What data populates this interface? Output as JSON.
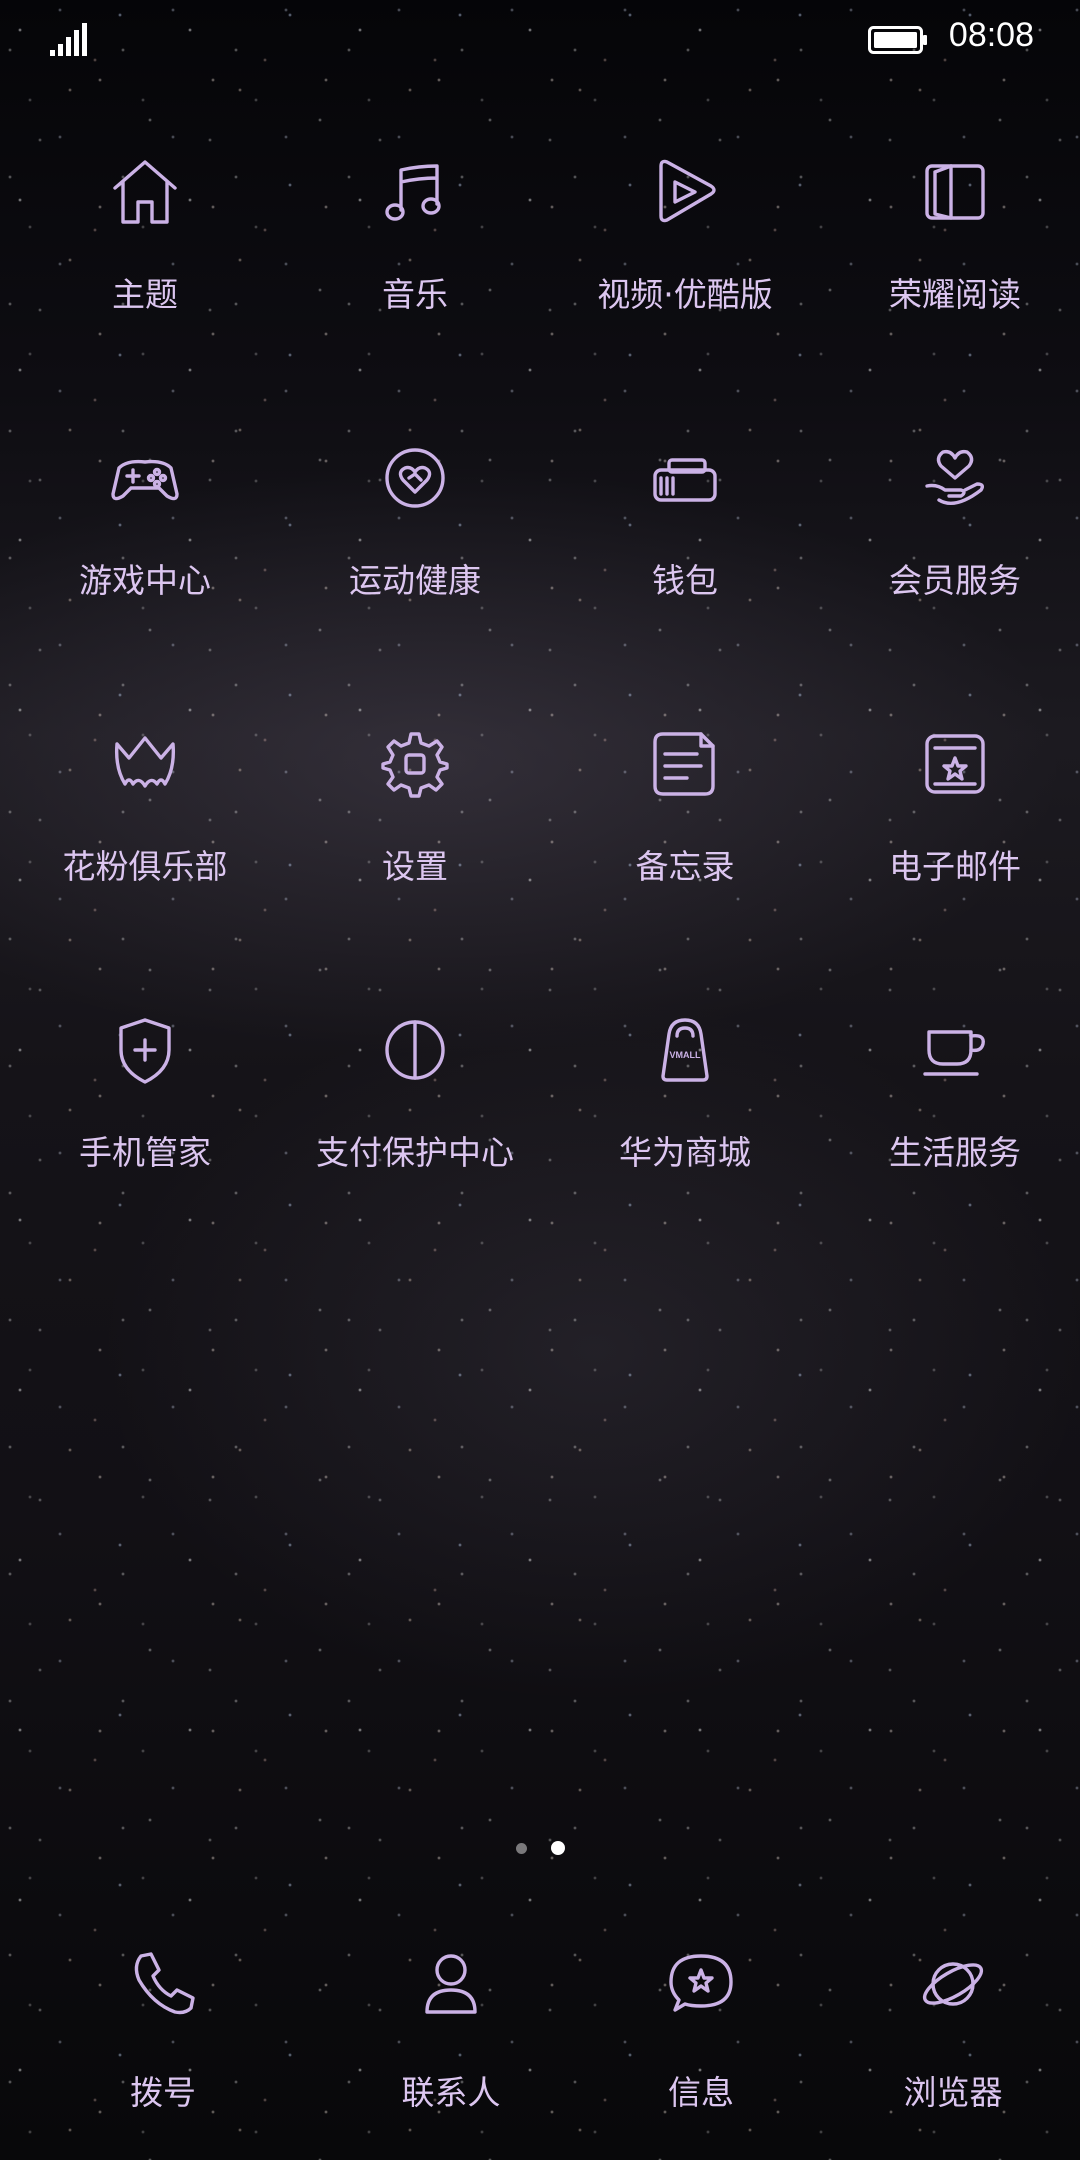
{
  "status_bar": {
    "time": "08:08",
    "signal_icon": "signal-bars-icon",
    "battery_icon": "battery-full-icon"
  },
  "theme": {
    "icon_color": "#cbb2e6",
    "label_color": "#dcc6f0"
  },
  "apps": [
    {
      "label": "主题",
      "icon": "home-icon"
    },
    {
      "label": "音乐",
      "icon": "music-note-icon"
    },
    {
      "label": "视频·优酷版",
      "icon": "play-icon"
    },
    {
      "label": "荣耀阅读",
      "icon": "book-icon"
    },
    {
      "label": "游戏中心",
      "icon": "gamepad-icon"
    },
    {
      "label": "运动健康",
      "icon": "heart-circle-icon"
    },
    {
      "label": "钱包",
      "icon": "wallet-icon"
    },
    {
      "label": "会员服务",
      "icon": "heart-hand-icon"
    },
    {
      "label": "花粉俱乐部",
      "icon": "crown-icon"
    },
    {
      "label": "设置",
      "icon": "gear-icon"
    },
    {
      "label": "备忘录",
      "icon": "notepad-icon"
    },
    {
      "label": "电子邮件",
      "icon": "mail-icon"
    },
    {
      "label": "手机管家",
      "icon": "shield-plus-icon"
    },
    {
      "label": "支付保护中心",
      "icon": "half-shield-icon"
    },
    {
      "label": "华为商城",
      "icon": "shopping-bag-icon",
      "badge": "VMALL"
    },
    {
      "label": "生活服务",
      "icon": "coffee-cup-icon"
    }
  ],
  "pager": {
    "pages": 2,
    "current": 2
  },
  "dock": [
    {
      "label": "拨号",
      "icon": "phone-icon"
    },
    {
      "label": "联系人",
      "icon": "contact-person-icon"
    },
    {
      "label": "信息",
      "icon": "message-bubble-icon"
    },
    {
      "label": "浏览器",
      "icon": "planet-icon"
    }
  ]
}
